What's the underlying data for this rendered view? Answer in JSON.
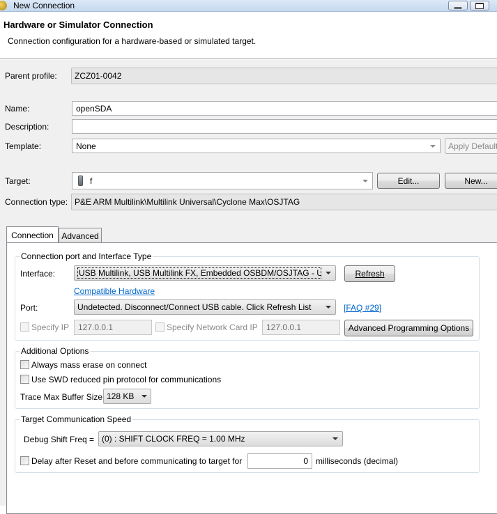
{
  "window": {
    "title": "New Connection"
  },
  "header": {
    "title": "Hardware or Simulator Connection",
    "subtitle": "Connection configuration for a hardware-based or simulated target."
  },
  "form": {
    "parent_profile_label": "Parent profile:",
    "parent_profile_value": "ZCZ01-0042",
    "name_label": "Name:",
    "name_value": "openSDA",
    "description_label": "Description:",
    "description_value": "",
    "template_label": "Template:",
    "template_value": "None",
    "apply_default_label": "Apply Default",
    "target_label": "Target:",
    "target_value": "f",
    "edit_label": "Edit...",
    "new_label": "New...",
    "connection_type_label": "Connection type:",
    "connection_type_value": "P&E ARM Multilink\\Multilink Universal\\Cyclone Max\\OSJTAG"
  },
  "tabs": [
    {
      "label": "Connection",
      "active": true
    },
    {
      "label": "Advanced",
      "active": false
    }
  ],
  "connection_port": {
    "group_title": "Connection port and Interface Type",
    "interface_label": "Interface:",
    "interface_value": "USB Multilink, USB Multilink FX, Embedded OSBDM/OSJTAG - USB",
    "refresh_label": "Refresh",
    "compatible_hardware_link": "Compatible Hardware",
    "port_label": "Port:",
    "port_value": "Undetected. Disconnect/Connect USB cable. Click Refresh List",
    "faq_link": "[FAQ #29]",
    "specify_ip_label": "Specify IP",
    "specify_ip_value": "127.0.0.1",
    "specify_network_card_ip_label": "Specify Network Card IP",
    "network_card_ip_value": "127.0.0.1",
    "advanced_programming_label": "Advanced Programming Options"
  },
  "additional_options": {
    "group_title": "Additional Options",
    "always_mass_erase_label": "Always mass erase on connect",
    "always_mass_erase_checked": false,
    "use_swd_label": "Use SWD reduced pin protocol for communications",
    "use_swd_checked": false,
    "trace_buffer_label": "Trace Max Buffer Size:",
    "trace_buffer_value": "128 KB"
  },
  "comm_speed": {
    "group_title": "Target Communication Speed",
    "debug_shift_label": "Debug Shift Freq =",
    "debug_shift_value": "(0) : SHIFT CLOCK FREQ = 1.00 MHz",
    "delay_label": "Delay after Reset and before communicating to target for",
    "delay_checked": false,
    "delay_value": "0",
    "delay_unit": "milliseconds (decimal)"
  },
  "icons": {
    "app_icon": "app-icon",
    "target_icon": "device-icon",
    "dropdown": "chevron-down-icon"
  },
  "colors": {
    "link": "#0066cc",
    "title_bar": "#dce9f7",
    "form_bg": "#f0f0f0"
  }
}
